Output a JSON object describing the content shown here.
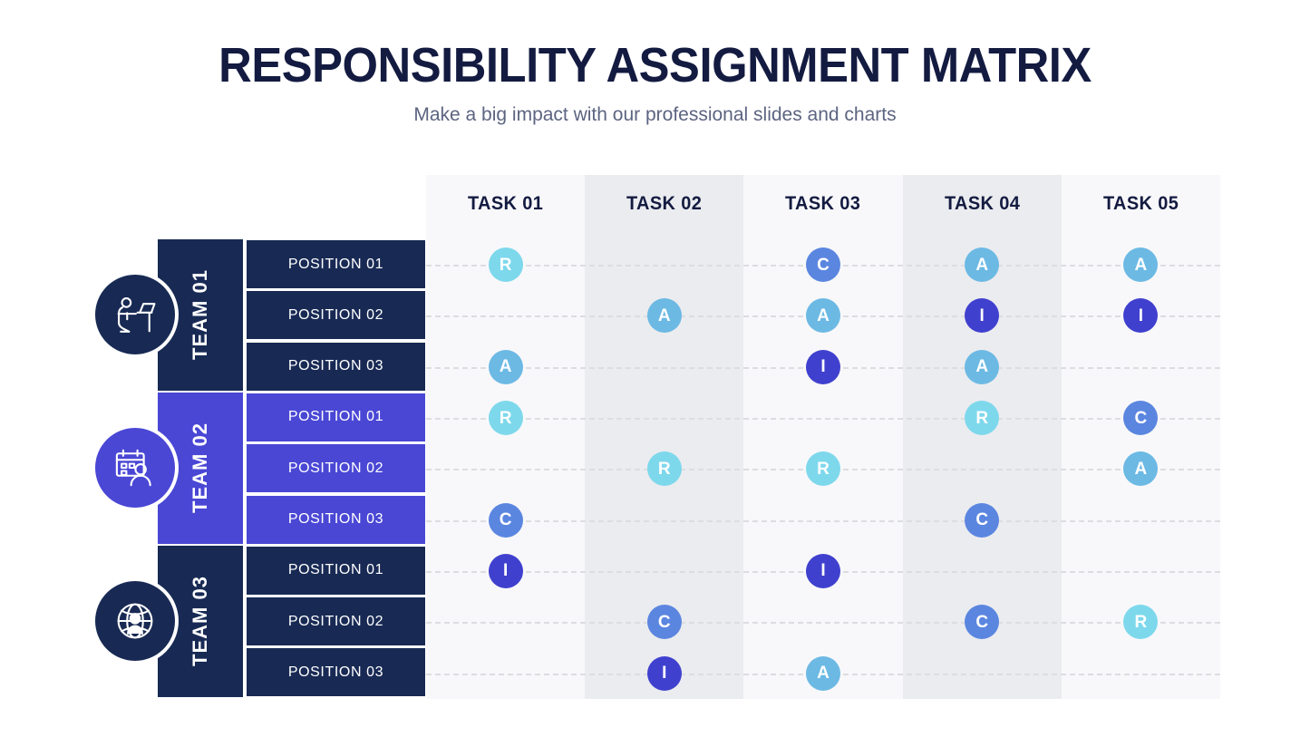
{
  "header": {
    "title": "RESPONSIBILITY ASSIGNMENT MATRIX",
    "subtitle": "Make a big impact with our professional slides and charts"
  },
  "colors": {
    "navy": "#182a54",
    "indigo": "#4a47d5",
    "title": "#141b41",
    "subtitle": "#5c6480",
    "stripe_light": "#f8f8fa",
    "stripe_dark": "#ebecef",
    "dash": "#dcdde2",
    "badge_R": "#7ed8ec",
    "badge_A": "#6cb9e4",
    "badge_C": "#5b86e0",
    "badge_I": "#4040cf"
  },
  "columns": [
    {
      "label": "TASK 01",
      "stripe": "#f8f8fa"
    },
    {
      "label": "TASK 02",
      "stripe": "#ebecef"
    },
    {
      "label": "TASK 03",
      "stripe": "#f8f8fa"
    },
    {
      "label": "TASK 04",
      "stripe": "#ebecef"
    },
    {
      "label": "TASK 05",
      "stripe": "#f8f8fa"
    }
  ],
  "teams": [
    {
      "label": "TEAM 01",
      "color": "#182a54",
      "icon": "person-at-desk-icon",
      "positions": [
        {
          "label": "POSITION 01",
          "assignments": [
            "R",
            "",
            "C",
            "A",
            "A"
          ]
        },
        {
          "label": "POSITION 02",
          "assignments": [
            "",
            "A",
            "A",
            "I",
            "I"
          ]
        },
        {
          "label": "POSITION 03",
          "assignments": [
            "A",
            "",
            "I",
            "A",
            ""
          ]
        }
      ]
    },
    {
      "label": "TEAM 02",
      "color": "#4a47d5",
      "icon": "calendar-person-icon",
      "positions": [
        {
          "label": "POSITION 01",
          "assignments": [
            "R",
            "",
            "",
            "R",
            "C"
          ]
        },
        {
          "label": "POSITION 02",
          "assignments": [
            "",
            "R",
            "R",
            "",
            "A"
          ]
        },
        {
          "label": "POSITION 03",
          "assignments": [
            "C",
            "",
            "",
            "C",
            ""
          ]
        }
      ]
    },
    {
      "label": "TEAM 03",
      "color": "#182a54",
      "icon": "globe-person-icon",
      "positions": [
        {
          "label": "POSITION 01",
          "assignments": [
            "I",
            "",
            "I",
            "",
            ""
          ]
        },
        {
          "label": "POSITION 02",
          "assignments": [
            "",
            "C",
            "",
            "C",
            "R"
          ]
        },
        {
          "label": "POSITION 03",
          "assignments": [
            "",
            "I",
            "A",
            "",
            ""
          ]
        }
      ]
    }
  ],
  "chart_data": {
    "type": "table",
    "title": "RESPONSIBILITY ASSIGNMENT MATRIX",
    "columns": [
      "TASK 01",
      "TASK 02",
      "TASK 03",
      "TASK 04",
      "TASK 05"
    ],
    "rows": [
      {
        "team": "TEAM 01",
        "position": "POSITION 01",
        "values": [
          "R",
          "",
          "C",
          "A",
          "A"
        ]
      },
      {
        "team": "TEAM 01",
        "position": "POSITION 02",
        "values": [
          "",
          "A",
          "A",
          "I",
          "I"
        ]
      },
      {
        "team": "TEAM 01",
        "position": "POSITION 03",
        "values": [
          "A",
          "",
          "I",
          "A",
          ""
        ]
      },
      {
        "team": "TEAM 02",
        "position": "POSITION 01",
        "values": [
          "R",
          "",
          "",
          "R",
          "C"
        ]
      },
      {
        "team": "TEAM 02",
        "position": "POSITION 02",
        "values": [
          "",
          "R",
          "R",
          "",
          "A"
        ]
      },
      {
        "team": "TEAM 02",
        "position": "POSITION 03",
        "values": [
          "C",
          "",
          "",
          "C",
          ""
        ]
      },
      {
        "team": "TEAM 03",
        "position": "POSITION 01",
        "values": [
          "I",
          "",
          "I",
          "",
          ""
        ]
      },
      {
        "team": "TEAM 03",
        "position": "POSITION 02",
        "values": [
          "",
          "C",
          "",
          "C",
          "R"
        ]
      },
      {
        "team": "TEAM 03",
        "position": "POSITION 03",
        "values": [
          "",
          "I",
          "A",
          "",
          ""
        ]
      }
    ],
    "legend": [
      "R",
      "A",
      "C",
      "I"
    ]
  }
}
